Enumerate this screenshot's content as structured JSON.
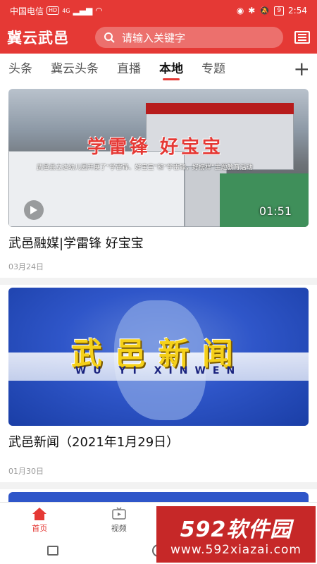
{
  "status": {
    "carrier": "中国电信",
    "hd": "HD",
    "net": "4G",
    "battery": "9",
    "time": "2:54"
  },
  "header": {
    "title": "冀云武邑",
    "search_placeholder": "请输入关键字"
  },
  "tabs": [
    {
      "label": "头条"
    },
    {
      "label": "冀云头条"
    },
    {
      "label": "直播"
    },
    {
      "label": "本地",
      "active": true
    },
    {
      "label": "专题"
    }
  ],
  "feed": [
    {
      "title": "武邑融媒|学雷锋 好宝宝",
      "date": "03月24日",
      "duration": "01:51",
      "overlay_title": "学雷锋  好宝宝",
      "overlay_sub": "武邑县立达幼儿园开展了“学雷锋、好宝宝”和“学雷锋，好榜样”主题教育活动"
    },
    {
      "title": "武邑新闻（2021年1月29日）",
      "date": "01月30日",
      "overlay_cn": "武邑新闻",
      "overlay_en": "WU YI XINWEN"
    }
  ],
  "nav": [
    {
      "label": "首页",
      "active": true
    },
    {
      "label": "视频"
    }
  ],
  "watermark": {
    "title": "592软件园",
    "url": "www.592xiazai.com"
  },
  "colors": {
    "accent": "#e53935"
  }
}
